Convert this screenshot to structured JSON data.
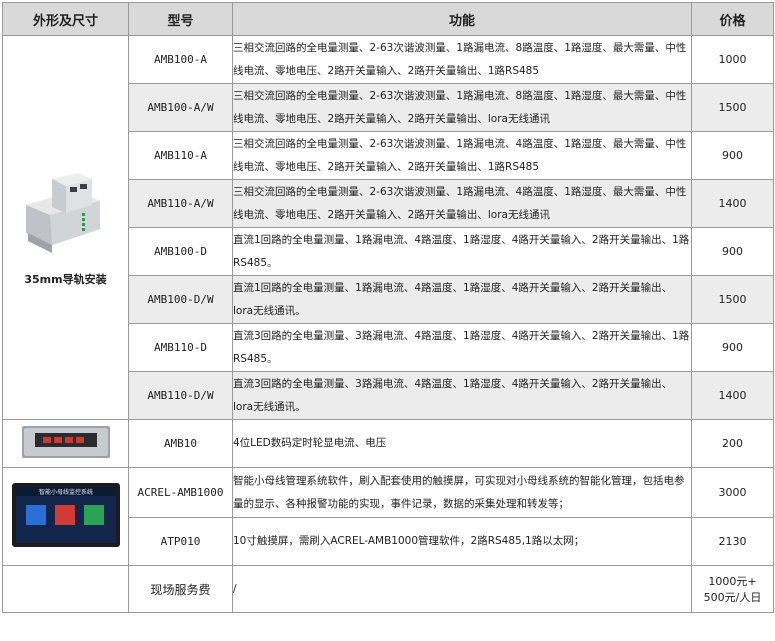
{
  "headers": {
    "shape": "外形及尺寸",
    "model": "型号",
    "function": "功能",
    "price": "价格"
  },
  "groups": {
    "din": {
      "label": "35mm导轨安装",
      "rows": [
        {
          "model": "AMB100-A",
          "function": "三相交流回路的全电量测量、2-63次谐波测量、1路漏电流、8路温度、1路湿度、最大需量、中性线电流、零地电压、2路开关量输入、2路开关量输出、1路RS485",
          "price": "1000"
        },
        {
          "model": "AMB100-A/W",
          "function": "三相交流回路的全电量测量、2-63次谐波测量、1路漏电流、8路温度、1路湿度、最大需量、中性线电流、零地电压、2路开关量输入、2路开关量输出、lora无线通讯",
          "price": "1500"
        },
        {
          "model": "AMB110-A",
          "function": "三相交流回路的全电量测量、2-63次谐波测量、1路漏电流、4路温度、1路湿度、最大需量、中性线电流、零地电压、2路开关量输入、2路开关量输出、1路RS485",
          "price": "900"
        },
        {
          "model": "AMB110-A/W",
          "function": "三相交流回路的全电量测量、2-63次谐波测量、1路漏电流、4路温度、1路湿度、最大需量、中性线电流、零地电压、2路开关量输入、2路开关量输出、lora无线通讯",
          "price": "1400"
        },
        {
          "model": "AMB100-D",
          "function": "直流1回路的全电量测量、1路漏电流、4路温度、1路湿度、4路开关量输入、2路开关量输出、1路RS485。",
          "price": "900"
        },
        {
          "model": "AMB100-D/W",
          "function": "直流1回路的全电量测量、1路漏电流、4路温度、1路湿度、4路开关量输入、2路开关量输出、lora无线通讯。",
          "price": "1500"
        },
        {
          "model": "AMB110-D",
          "function": "直流3回路的全电量测量、3路漏电流、4路温度、1路湿度、4路开关量输入、2路开关量输出、1路RS485。",
          "price": "900"
        },
        {
          "model": "AMB110-D/W",
          "function": "直流3回路的全电量测量、3路漏电流、4路温度、1路湿度、4路开关量输入、2路开关量输出、lora无线通讯。",
          "price": "1400"
        }
      ]
    },
    "led": {
      "rows": [
        {
          "model": "AMB10",
          "function": "4位LED数码定时轮显电流、电压",
          "price": "200"
        }
      ]
    },
    "screen": {
      "screen_title": "智能小母线监控系统",
      "rows": [
        {
          "model": "ACREL-AMB1000",
          "function": "智能小母线管理系统软件，刷入配套使用的触摸屏，可实现对小母线系统的智能化管理，包括电参量的显示、各种报警功能的实现，事件记录，数据的采集处理和转发等；",
          "price": "3000"
        },
        {
          "model": "ATP010",
          "function": "10寸触摸屏，需刷入ACREL-AMB1000管理软件，2路RS485,1路以太网；",
          "price": "2130"
        }
      ]
    },
    "service": {
      "model": "现场服务费",
      "function": "/",
      "price_line1": "1000元+",
      "price_line2": "500元/人日"
    }
  },
  "colors": {
    "header_bg": "#d9d9d9",
    "shaded_row": "#ececec",
    "border": "#9a9a9a"
  }
}
